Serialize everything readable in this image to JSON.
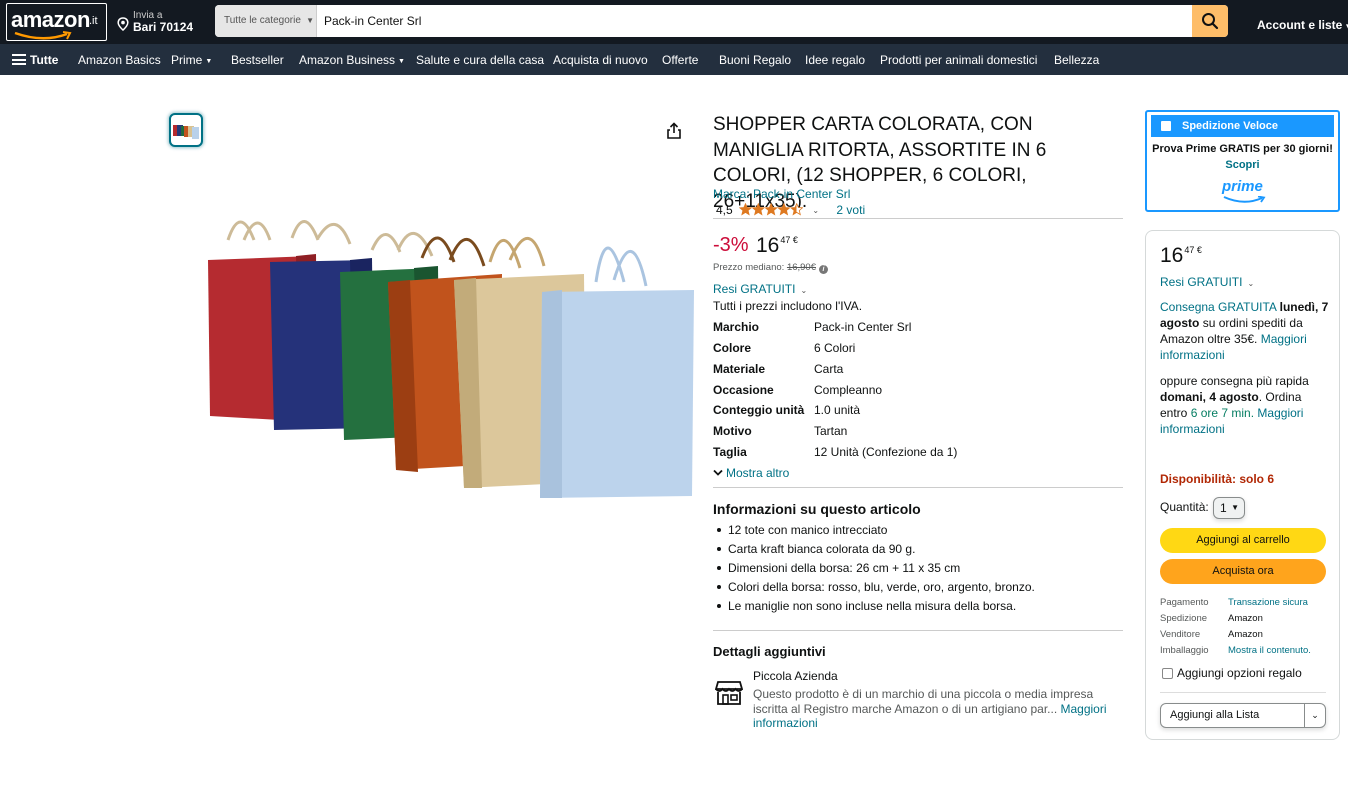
{
  "header": {
    "logo_text": "amazon",
    "logo_tld": ".it",
    "deliver_line1": "Invia a",
    "deliver_line2": "Bari 70124",
    "search_category": "Tutte le categorie",
    "search_value": "Pack-in Center Srl",
    "account_label": "Account e liste"
  },
  "nav": {
    "all_label": "Tutte",
    "items": [
      "Amazon Basics",
      "Prime",
      "Bestseller",
      "Amazon Business",
      "Salute e cura della casa",
      "Acquista di nuovo",
      "Offerte",
      "Buoni Regalo",
      "Idee regalo",
      "Prodotti per animali domestici",
      "Bellezza"
    ]
  },
  "product": {
    "title": "SHOPPER CARTA COLORATA, CON MANIGLIA RITORTA, ASSORTITE IN 6 COLORI, (12 SHOPPER, 6 COLORI, 26+11x35).",
    "brand_link": "Marca: Pack-in Center Srl",
    "rating_value": "4,5",
    "rating_stars": 4.5,
    "votes": "2 voti",
    "discount": "-3%",
    "price_main": "16",
    "price_cents": "47",
    "currency": "€",
    "median_label": "Prezzo mediano:",
    "median_price": "16,90€",
    "returns": "Resi GRATUITI",
    "vat_note": "Tutti i prezzi includono l'IVA.",
    "specs": [
      {
        "k": "Marchio",
        "v": "Pack-in Center Srl"
      },
      {
        "k": "Colore",
        "v": "6 Colori"
      },
      {
        "k": "Materiale",
        "v": "Carta"
      },
      {
        "k": "Occasione",
        "v": "Compleanno"
      },
      {
        "k": "Conteggio unità",
        "v": "1.0 unità"
      },
      {
        "k": "Motivo",
        "v": "Tartan"
      },
      {
        "k": "Taglia",
        "v": "12 Unità (Confezione da 1)"
      }
    ],
    "show_more": "Mostra altro",
    "about_title": "Informazioni su questo articolo",
    "bullets": [
      "12 tote con manico intrecciato",
      "Carta kraft bianca colorata da 90 g.",
      "Dimensioni della borsa: 26 cm + 11 x 35 cm",
      "Colori della borsa: rosso, blu, verde, oro, argento, bronzo.",
      "Le maniglie non sono incluse nella misura della borsa."
    ],
    "extra_title": "Dettagli aggiuntivi",
    "small_biz_title": "Piccola Azienda",
    "small_biz_desc": "Questo prodotto è di un marchio di una piccola o media impresa iscritta al Registro marche Amazon o di un artigiano par...",
    "small_biz_link": "Maggiori informazioni"
  },
  "prime_box": {
    "header": "Spedizione Veloce",
    "line1": "Prova Prime GRATIS per 30 giorni!",
    "line2": "Scopri",
    "logo": "prime"
  },
  "buybox": {
    "price_main": "16",
    "price_cents": "47",
    "currency": "€",
    "returns": "Resi GRATUITI",
    "delivery_a": "Consegna GRATUITA",
    "delivery_b": "lunedì, 7 agosto",
    "delivery_c": "su ordini spediti da Amazon oltre 35€.",
    "delivery_link": "Maggiori informazioni",
    "fast_a": "oppure consegna più rapida",
    "fast_b": "domani, 4 agosto",
    "fast_c": ". Ordina entro",
    "fast_d": "6 ore 7 min.",
    "fast_link": "Maggiori informazioni",
    "availability": "Disponibilità: solo 6",
    "qty_label": "Quantità:",
    "qty_value": "1",
    "add_to_cart": "Aggiungi al carrello",
    "buy_now": "Acquista ora",
    "meta": [
      {
        "k": "Pagamento",
        "v": "Transazione sicura",
        "link": true
      },
      {
        "k": "Spedizione",
        "v": "Amazon",
        "link": false
      },
      {
        "k": "Venditore",
        "v": "Amazon",
        "link": false
      },
      {
        "k": "Imballaggio",
        "v": "Mostra il contenuto.",
        "link": true
      }
    ],
    "gift": "Aggiungi opzioni regalo",
    "add_list": "Aggiungi alla Lista"
  },
  "colors": {
    "header_bg": "#131921",
    "nav_bg": "#232f3e",
    "search_btn": "#febd69",
    "link": "#007185",
    "star": "#de7921",
    "discount": "#cc0c39",
    "cart_btn": "#ffd814",
    "buy_btn": "#ffa41c",
    "prime_blue": "#1a98ff"
  }
}
